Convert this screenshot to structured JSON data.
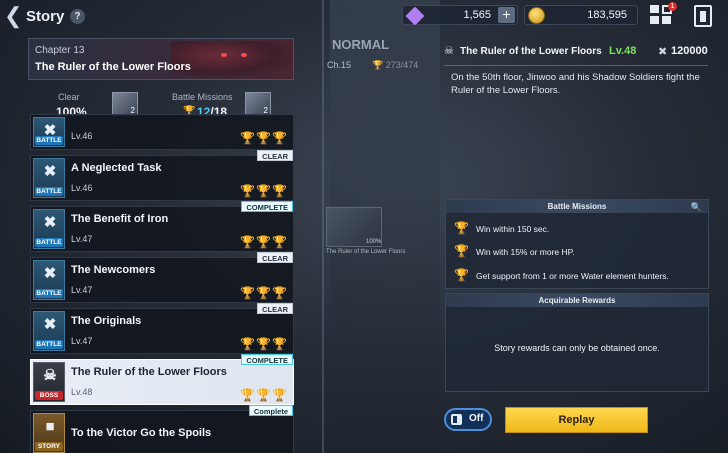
{
  "topbar": {
    "title": "Story",
    "help": "?",
    "gems": "1,565",
    "gold": "183,595",
    "plus": "+",
    "notification_count": "1"
  },
  "chapter": {
    "label": "Chapter 13",
    "name": "The Ruler of the Lower Floors",
    "clear_label": "Clear",
    "clear_value": "100%",
    "clear_box_count": "2",
    "missions_label": "Battle Missions",
    "missions_done": "12",
    "missions_total": "/18",
    "missions_box_count": "2"
  },
  "map": {
    "difficulty": "NORMAL",
    "chapter": "Ch.15",
    "progress": "273/474",
    "thumb_percent": "100%",
    "thumb_caption": "The Ruler of the Lower Floors"
  },
  "stages": [
    {
      "title": "",
      "level": "Lv.46",
      "type": "BATTLE",
      "status": "",
      "trophies": [
        true,
        false,
        true
      ]
    },
    {
      "title": "A Neglected Task",
      "level": "Lv.46",
      "type": "BATTLE",
      "status": "CLEAR",
      "trophies": [
        true,
        false,
        false
      ]
    },
    {
      "title": "The Benefit of Iron",
      "level": "Lv.47",
      "type": "BATTLE",
      "status": "COMPLETE",
      "trophies": [
        true,
        true,
        true
      ]
    },
    {
      "title": "The Newcomers",
      "level": "Lv.47",
      "type": "BATTLE",
      "status": "CLEAR",
      "trophies": [
        true,
        false,
        true
      ]
    },
    {
      "title": "The Originals",
      "level": "Lv.47",
      "type": "BATTLE",
      "status": "CLEAR",
      "trophies": [
        false,
        true,
        true
      ]
    },
    {
      "title": "The Ruler of the Lower Floors",
      "level": "Lv.48",
      "type": "BOSS",
      "status": "COMPLETE",
      "trophies": [
        true,
        true,
        true
      ]
    },
    {
      "title": "To the Victor Go the Spoils",
      "level": "",
      "type": "STORY",
      "status": "Complete",
      "trophies": []
    }
  ],
  "detail": {
    "title": "The Ruler of the Lower Floors",
    "level": "Lv.48",
    "power": "120000",
    "description": "On the 50th floor, Jinwoo and his Shadow Soldiers fight the Ruler of the Lower Floors."
  },
  "battle_missions": {
    "header": "Battle Missions",
    "items": [
      "Win within 150 sec.",
      "Win with 15% or more HP.",
      "Get support from 1 or more Water element hunters."
    ]
  },
  "rewards": {
    "header": "Acquirable Rewards",
    "text": "Story rewards can only be obtained once."
  },
  "controls": {
    "auto_label": "Off",
    "replay_label": "Replay"
  },
  "colors": {
    "accent_gold": "#f0b81a",
    "level_green": "#7de05a",
    "missions_blue": "#51c7f2",
    "boss_red": "#c9252c"
  }
}
